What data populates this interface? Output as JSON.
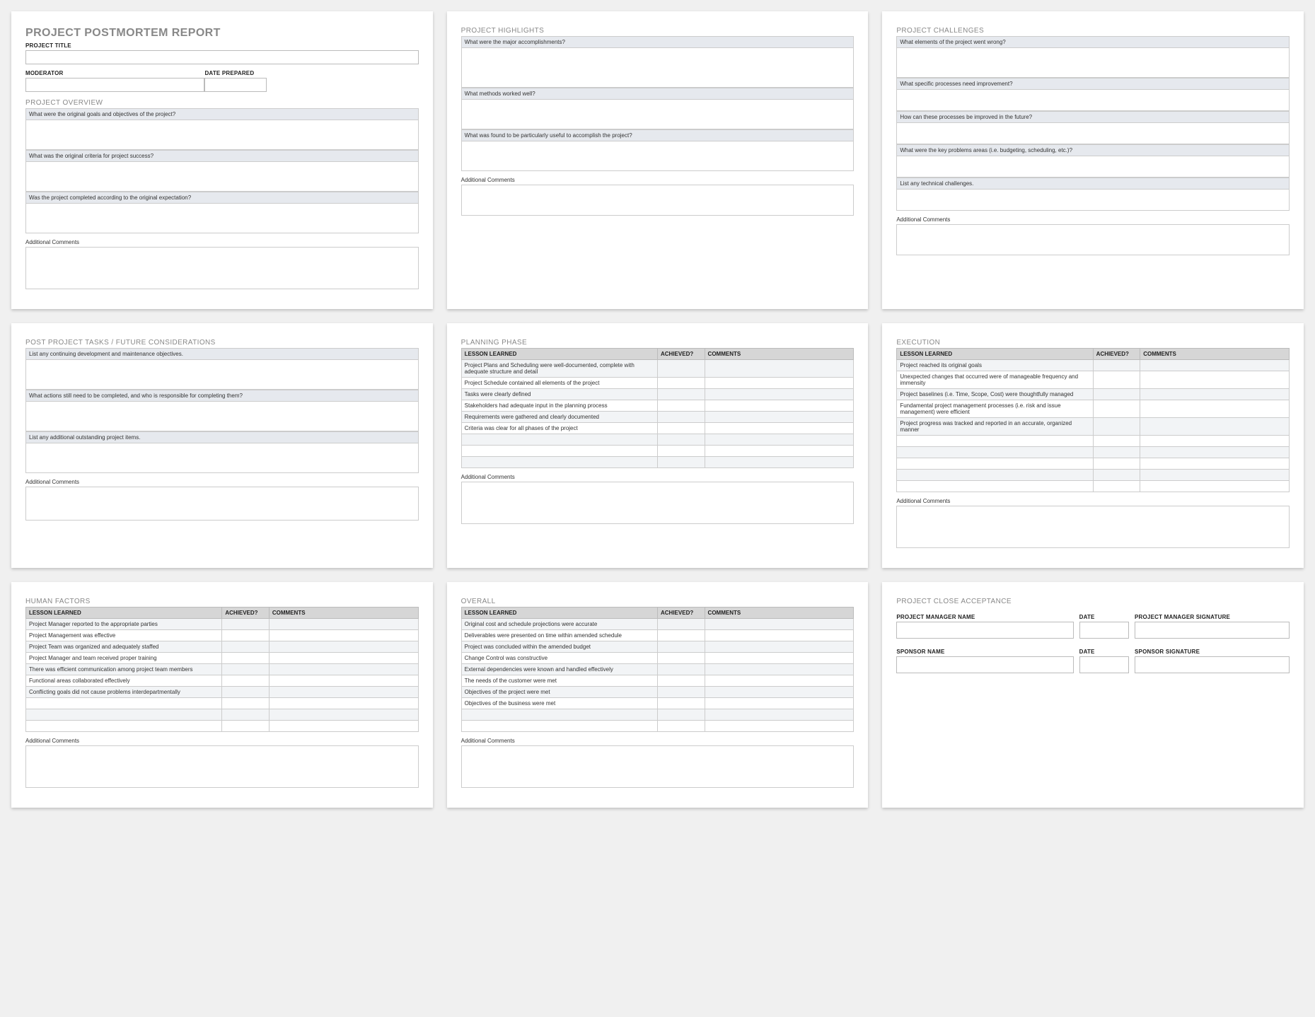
{
  "report": {
    "title": "PROJECT POSTMORTEM REPORT",
    "project_title_label": "PROJECT TITLE",
    "project_title_value": "",
    "moderator_label": "MODERATOR",
    "moderator_value": "",
    "date_prepared_label": "DATE PREPARED",
    "date_prepared_value": ""
  },
  "overview": {
    "heading": "PROJECT OVERVIEW",
    "q1": "What were the original goals and objectives of the project?",
    "q2": "What was the original criteria for project success?",
    "q3": "Was the project completed according to the original expectation?",
    "comments_label": "Additional Comments"
  },
  "highlights": {
    "heading": "PROJECT HIGHLIGHTS",
    "q1": "What were the major accomplishments?",
    "q2": "What methods worked well?",
    "q3": "What was found to be particularly useful to accomplish the project?",
    "comments_label": "Additional Comments"
  },
  "challenges": {
    "heading": "PROJECT CHALLENGES",
    "q1": "What elements of the project went wrong?",
    "q2": "What specific processes need improvement?",
    "q3": "How can these processes be improved in the future?",
    "q4": "What were the key problems areas (i.e. budgeting, scheduling, etc.)?",
    "q5": "List any technical challenges.",
    "comments_label": "Additional Comments"
  },
  "postproject": {
    "heading": "POST PROJECT TASKS / FUTURE CONSIDERATIONS",
    "q1": "List any continuing development and maintenance objectives.",
    "q2": "What actions still need to be completed, and who is responsible for completing them?",
    "q3": "List any additional outstanding project items.",
    "comments_label": "Additional Comments"
  },
  "table_headers": {
    "lesson": "LESSON LEARNED",
    "achieved": "ACHIEVED?",
    "comments": "COMMENTS"
  },
  "planning": {
    "heading": "PLANNING PHASE",
    "rows": [
      "Project Plans and Scheduling were well-documented, complete with adequate structure and detail",
      "Project Schedule contained all elements of the project",
      "Tasks were clearly defined",
      "Stakeholders had adequate input in the planning process",
      "Requirements were gathered and clearly documented",
      "Criteria was clear for all phases of the project",
      "",
      "",
      ""
    ],
    "comments_label": "Additional Comments"
  },
  "execution": {
    "heading": "EXECUTION",
    "rows": [
      "Project reached its original goals",
      "Unexpected changes that occurred were of manageable frequency and immensity",
      "Project baselines (i.e. Time, Scope, Cost) were thoughtfully managed",
      "Fundamental project management processes (i.e. risk and issue management) were efficient",
      "Project progress was tracked and reported in an accurate, organized manner",
      "",
      "",
      "",
      "",
      ""
    ],
    "comments_label": "Additional Comments"
  },
  "human": {
    "heading": "HUMAN FACTORS",
    "rows": [
      "Project Manager reported to the appropriate parties",
      "Project Management was effective",
      "Project Team was organized and adequately staffed",
      "Project Manager and team received proper training",
      "There was efficient communication among project team members",
      "Functional areas collaborated effectively",
      "Conflicting goals did not cause problems interdepartmentally",
      "",
      "",
      ""
    ],
    "comments_label": "Additional Comments"
  },
  "overall": {
    "heading": "OVERALL",
    "rows": [
      "Original cost and schedule projections were accurate",
      "Deliverables were presented on time within amended schedule",
      "Project was concluded within the amended budget",
      "Change Control was constructive",
      "External dependencies were known and handled effectively",
      "The needs of the customer were met",
      "Objectives of the project were met",
      "Objectives of the business were met",
      "",
      ""
    ],
    "comments_label": "Additional Comments"
  },
  "acceptance": {
    "heading": "PROJECT CLOSE ACCEPTANCE",
    "pm_name_label": "PROJECT MANAGER NAME",
    "pm_date_label": "DATE",
    "pm_sign_label": "PROJECT MANAGER SIGNATURE",
    "sponsor_name_label": "SPONSOR NAME",
    "sponsor_date_label": "DATE",
    "sponsor_sign_label": "SPONSOR SIGNATURE"
  }
}
